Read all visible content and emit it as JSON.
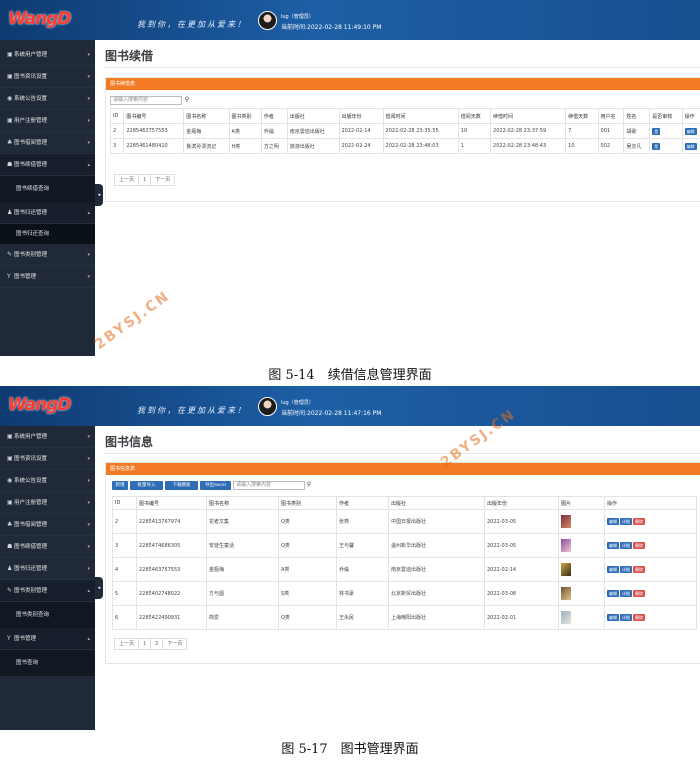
{
  "logo": "WangD",
  "slogan": "我到你，在更加从爱来！",
  "user": {
    "name": "lug（管理员）",
    "time1": "当前时间:2022-02-28 11:49:10 PM",
    "time2": "当前时间:2022-02-28 11:47:16 PM"
  },
  "watermark": "2BYSJ.CN",
  "s1": {
    "menu": [
      "系统用户管理",
      "图书资讯设置",
      "系统公告设置",
      "用户注册管理",
      "图书借阅管理",
      "图书续借管理"
    ],
    "sub1": "图书续借查询",
    "menu2": "图书归还管理",
    "sub2": "图书归还查询",
    "menu3": [
      "图书类别管理",
      "图书管理"
    ],
    "title": "图书续借",
    "panel": "图书续借表",
    "search_ph": "请输入搜索内容",
    "columns": [
      "ID",
      "图书编号",
      "图书名称",
      "图书类别",
      "作者",
      "出版社",
      "出版年份",
      "借阅时间",
      "借阅天数",
      "续借时间",
      "续借天数",
      "用户名",
      "姓名",
      "是否审核",
      "操作"
    ],
    "rows": [
      [
        "2",
        "2285463757553",
        "金瓶梅",
        "A类",
        "乔倫",
        "南京雲迪出版社",
        "2022-02-14",
        "2022-02-28 23:35:55",
        "10",
        "2022-02-28 23:37:59",
        "7",
        "001",
        "胡歌",
        "是",
        "编辑"
      ],
      [
        "3",
        "2285461480410",
        "鲁滨孙漂流记",
        "H类",
        "方之明",
        "旅游出版社",
        "2022-02-24",
        "2022-02-28 23:48:03",
        "1",
        "2022-02-28 23:48:43",
        "10",
        "002",
        "吴亦凡",
        "是",
        "编辑"
      ]
    ],
    "pager": [
      "上一页",
      "1",
      "下一页"
    ]
  },
  "caption1": "图 5-14　续借信息管理界面",
  "s2": {
    "menu": [
      "系统用户管理",
      "图书资讯设置",
      "系统公告设置",
      "用户注册管理",
      "图书借阅管理",
      "图书续借管理",
      "图书归还管理",
      "图书类别管理"
    ],
    "sub1": "图书类别查询",
    "menu2": "图书管理",
    "sub2": "图书查询",
    "title": "图书信息",
    "panel": "图书信息表",
    "toolbar": [
      "新增",
      "批量导入",
      "下载模板",
      "导出excel"
    ],
    "search_ph": "请输入搜索内容",
    "columns": [
      "ID",
      "图书编号",
      "图书名称",
      "图书类别",
      "作者",
      "出版社",
      "出版年份",
      "图片",
      "操作"
    ],
    "rows": [
      [
        "2",
        "2285413767974",
        "花者文集",
        "Q类",
        "张燕",
        "中国日报出版社",
        "2022-03-05"
      ],
      [
        "3",
        "2285474686305",
        "安徒生童话",
        "Q类",
        "王与馨",
        "温州新华出版社",
        "2022-03-05"
      ],
      [
        "4",
        "2285463757553",
        "金瓶梅",
        "A类",
        "乔倫",
        "南京雲迪出版社",
        "2022-02-14"
      ],
      [
        "5",
        "2285402748022",
        "方与圆",
        "S类",
        "林书豪",
        "北京新贸出版社",
        "2022-03-08"
      ],
      [
        "6",
        "2285422490931",
        "简爱",
        "Q类",
        "王永民",
        "上海楠阳出版社",
        "2022-02-01"
      ]
    ],
    "actions": [
      "编辑",
      "详细",
      "删除"
    ],
    "pager": [
      "上一页",
      "1",
      "2",
      "下一页"
    ]
  },
  "caption2": "图 5-17　图书管理界面"
}
